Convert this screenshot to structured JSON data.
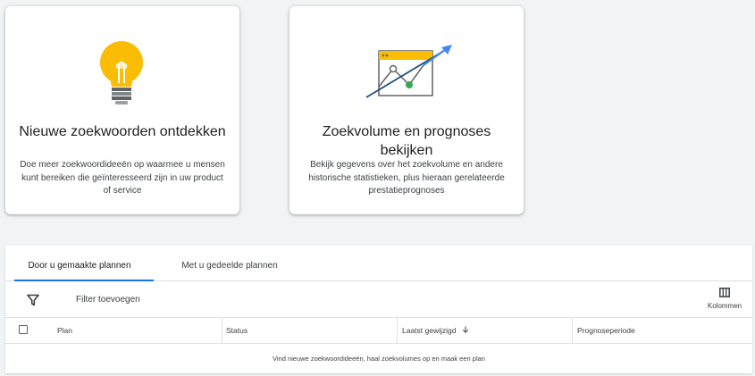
{
  "cards": [
    {
      "title": "Nieuwe zoekwoorden ontdekken",
      "description": "Doe meer zoekwoordideeën op waarmee u mensen kunt bereiken die geïnteresseerd zijn in uw product of service",
      "icon": "lightbulb-icon"
    },
    {
      "title": "Zoekvolume en prognoses bekijken",
      "description": "Bekijk gegevens over het zoekvolume en andere historische statistieken, plus hieraan gerelateerde prestatieprognoses",
      "icon": "trend-chart-icon"
    }
  ],
  "tabs": [
    {
      "label": "Door u gemaakte plannen",
      "active": true
    },
    {
      "label": "Met u gedeelde plannen",
      "active": false
    }
  ],
  "filter": {
    "label": "Filter toevoegen",
    "icon": "filter-icon"
  },
  "columns_button": {
    "label": "Kolommen",
    "icon": "columns-icon"
  },
  "table": {
    "headers": [
      "Plan",
      "Status",
      "Laatst gewijzigd",
      "Prognoseperiode"
    ],
    "sorted_column": "Laatst gewijzigd",
    "sort_direction": "descending",
    "empty_message": "Vind nieuwe zoekwoordideeën, haal zoekvolumes op en maak een plan"
  },
  "colors": {
    "accent": "#1a73e8",
    "bulb": "#fbbc04",
    "chart_point": "#34a853",
    "background": "#f1f3f4"
  }
}
